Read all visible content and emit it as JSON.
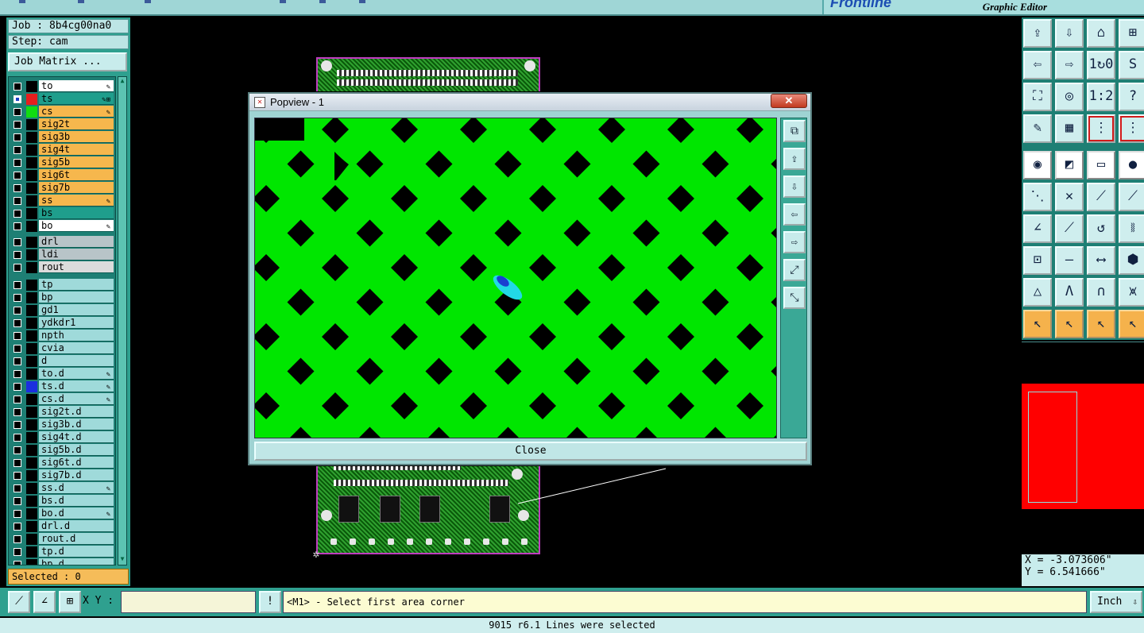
{
  "app": {
    "subtitle": "Graphic Editor",
    "brand": "Frontline"
  },
  "job": {
    "job_line": "Job : 8b4cg00na0",
    "step_line": "Step: cam",
    "matrix_button": "Job Matrix ..."
  },
  "layers_group1": [
    {
      "name": "to",
      "bg": "#ffffff",
      "swatch": "#000000",
      "selected": false,
      "mark": "✎"
    },
    {
      "name": "ts",
      "bg": "#1f9e8c",
      "swatch": "#e51e1e",
      "selected": true,
      "mark": "✎⊞"
    },
    {
      "name": "cs",
      "bg": "#f6b74d",
      "swatch": "#11dd11",
      "selected": false,
      "mark": "✎"
    },
    {
      "name": "sig2t",
      "bg": "#f6b74d",
      "swatch": "#000000",
      "selected": false,
      "mark": ""
    },
    {
      "name": "sig3b",
      "bg": "#f6b74d",
      "swatch": "#000000",
      "selected": false,
      "mark": ""
    },
    {
      "name": "sig4t",
      "bg": "#f6b74d",
      "swatch": "#000000",
      "selected": false,
      "mark": ""
    },
    {
      "name": "sig5b",
      "bg": "#f6b74d",
      "swatch": "#000000",
      "selected": false,
      "mark": ""
    },
    {
      "name": "sig6t",
      "bg": "#f6b74d",
      "swatch": "#000000",
      "selected": false,
      "mark": ""
    },
    {
      "name": "sig7b",
      "bg": "#f6b74d",
      "swatch": "#000000",
      "selected": false,
      "mark": ""
    },
    {
      "name": "ss",
      "bg": "#f6b74d",
      "swatch": "#000000",
      "selected": false,
      "mark": "✎"
    },
    {
      "name": "bs",
      "bg": "#1f9e8c",
      "swatch": "#000000",
      "selected": false,
      "mark": ""
    },
    {
      "name": "bo",
      "bg": "#ffffff",
      "swatch": "#000000",
      "selected": false,
      "mark": "✎"
    }
  ],
  "layers_group2": [
    {
      "name": "drl",
      "bg": "#b8c4c8",
      "swatch": "#000000",
      "selected": false,
      "mark": ""
    },
    {
      "name": "ldi",
      "bg": "#b8c4c8",
      "swatch": "#000000",
      "selected": false,
      "mark": ""
    },
    {
      "name": "rout",
      "bg": "#dcdcdc",
      "swatch": "#000000",
      "selected": false,
      "mark": ""
    }
  ],
  "layers_group3": [
    {
      "name": "tp",
      "bg": "#9fdada",
      "swatch": "#000000",
      "selected": false,
      "mark": ""
    },
    {
      "name": "bp",
      "bg": "#9fdada",
      "swatch": "#000000",
      "selected": false,
      "mark": ""
    },
    {
      "name": "gd1",
      "bg": "#9fdada",
      "swatch": "#000000",
      "selected": false,
      "mark": ""
    },
    {
      "name": "ydkdr1",
      "bg": "#9fdada",
      "swatch": "#000000",
      "selected": false,
      "mark": ""
    },
    {
      "name": "npth",
      "bg": "#9fdada",
      "swatch": "#000000",
      "selected": false,
      "mark": ""
    },
    {
      "name": "cvia",
      "bg": "#9fdada",
      "swatch": "#000000",
      "selected": false,
      "mark": ""
    },
    {
      "name": "d",
      "bg": "#9fdada",
      "swatch": "#000000",
      "selected": false,
      "mark": ""
    },
    {
      "name": "to.d",
      "bg": "#9fdada",
      "swatch": "#000000",
      "selected": false,
      "mark": "✎"
    },
    {
      "name": "ts.d",
      "bg": "#9fdada",
      "swatch": "#1b2fe0",
      "selected": false,
      "mark": "✎"
    },
    {
      "name": "cs.d",
      "bg": "#9fdada",
      "swatch": "#000000",
      "selected": false,
      "mark": "✎"
    },
    {
      "name": "sig2t.d",
      "bg": "#9fdada",
      "swatch": "#000000",
      "selected": false,
      "mark": ""
    },
    {
      "name": "sig3b.d",
      "bg": "#9fdada",
      "swatch": "#000000",
      "selected": false,
      "mark": ""
    },
    {
      "name": "sig4t.d",
      "bg": "#9fdada",
      "swatch": "#000000",
      "selected": false,
      "mark": ""
    },
    {
      "name": "sig5b.d",
      "bg": "#9fdada",
      "swatch": "#000000",
      "selected": false,
      "mark": ""
    },
    {
      "name": "sig6t.d",
      "bg": "#9fdada",
      "swatch": "#000000",
      "selected": false,
      "mark": ""
    },
    {
      "name": "sig7b.d",
      "bg": "#9fdada",
      "swatch": "#000000",
      "selected": false,
      "mark": ""
    },
    {
      "name": "ss.d",
      "bg": "#9fdada",
      "swatch": "#000000",
      "selected": false,
      "mark": "✎"
    },
    {
      "name": "bs.d",
      "bg": "#9fdada",
      "swatch": "#000000",
      "selected": false,
      "mark": ""
    },
    {
      "name": "bo.d",
      "bg": "#9fdada",
      "swatch": "#000000",
      "selected": false,
      "mark": "✎"
    },
    {
      "name": "drl.d",
      "bg": "#9fdada",
      "swatch": "#000000",
      "selected": false,
      "mark": ""
    },
    {
      "name": "rout.d",
      "bg": "#9fdada",
      "swatch": "#000000",
      "selected": false,
      "mark": ""
    },
    {
      "name": "tp.d",
      "bg": "#9fdada",
      "swatch": "#000000",
      "selected": false,
      "mark": ""
    },
    {
      "name": "bp.d",
      "bg": "#9fdada",
      "swatch": "#000000",
      "selected": false,
      "mark": ""
    }
  ],
  "selected_counter": "Selected : 0",
  "popview": {
    "title": "Popview - 1",
    "close_x": "✕",
    "close_button": "Close",
    "tools": [
      "⧉",
      "⇪",
      "⇩",
      "⇦",
      "⇨",
      "⤢",
      "⤡"
    ]
  },
  "right_toolbar": {
    "buttons": [
      {
        "name": "zoom-home-button",
        "icon": "⇪",
        "style": ""
      },
      {
        "name": "zoom-down-button",
        "icon": "⇩",
        "style": ""
      },
      {
        "name": "home-button",
        "icon": "⌂",
        "style": ""
      },
      {
        "name": "window-layout-button",
        "icon": "⊞",
        "style": ""
      },
      {
        "name": "pan-left-button",
        "icon": "⇦",
        "style": ""
      },
      {
        "name": "pan-right-button",
        "icon": "⇨",
        "style": ""
      },
      {
        "name": "one-to-zero-button",
        "icon": "1↻0",
        "style": ""
      },
      {
        "name": "snap-button",
        "icon": "S",
        "style": ""
      },
      {
        "name": "fit-button",
        "icon": "⛶",
        "style": ""
      },
      {
        "name": "center-button",
        "icon": "◎",
        "style": ""
      },
      {
        "name": "ratio-button",
        "icon": "1:2",
        "style": ""
      },
      {
        "name": "help-button",
        "icon": "?",
        "style": ""
      },
      {
        "name": "measure-button",
        "icon": "✎",
        "style": ""
      },
      {
        "name": "grid-button",
        "icon": "▦",
        "style": ""
      },
      {
        "name": "net-connect-button",
        "icon": "⋮",
        "style": "redframe"
      },
      {
        "name": "net-highlight-button",
        "icon": "⋮",
        "style": "redframe"
      },
      {
        "name": "pad-select-button",
        "icon": "◉",
        "style": "white"
      },
      {
        "name": "layer-color-button",
        "icon": "◩",
        "style": "white"
      },
      {
        "name": "ruler-button",
        "icon": "▭",
        "style": "white"
      },
      {
        "name": "circle-button",
        "icon": "●",
        "style": "white"
      },
      {
        "name": "connect-points-button",
        "icon": "⋱",
        "style": ""
      },
      {
        "name": "cross-button",
        "icon": "✕",
        "style": ""
      },
      {
        "name": "line-point-button",
        "icon": "⟋",
        "style": ""
      },
      {
        "name": "line-end-button",
        "icon": "⟋",
        "style": ""
      },
      {
        "name": "angle-line-button",
        "icon": "∠",
        "style": ""
      },
      {
        "name": "diagonal-button",
        "icon": "⟋",
        "style": ""
      },
      {
        "name": "arc-button",
        "icon": "↺",
        "style": ""
      },
      {
        "name": "mirror-button",
        "icon": "⧚",
        "style": ""
      },
      {
        "name": "move-pad-button",
        "icon": "⊡",
        "style": ""
      },
      {
        "name": "horizontal-line-button",
        "icon": "—",
        "style": ""
      },
      {
        "name": "dimension-button",
        "icon": "⟷",
        "style": ""
      },
      {
        "name": "shapes-button",
        "icon": "⬢",
        "style": ""
      },
      {
        "name": "triangle-button",
        "icon": "△",
        "style": ""
      },
      {
        "name": "a-shape-button",
        "icon": "Λ",
        "style": ""
      },
      {
        "name": "arch-button",
        "icon": "∩",
        "style": ""
      },
      {
        "name": "cross-shape-button",
        "icon": "⩙",
        "style": ""
      },
      {
        "name": "select-button",
        "icon": "↖",
        "style": "orange"
      },
      {
        "name": "select-box-button",
        "icon": "↖",
        "style": "orange"
      },
      {
        "name": "select-poly-button",
        "icon": "↖",
        "style": "orange"
      },
      {
        "name": "select-step-button",
        "icon": "↖",
        "style": "orange"
      }
    ]
  },
  "coords": {
    "x": "X = -3.073606\"",
    "y": "Y =  6.541666\""
  },
  "bottom": {
    "xy_label": "X Y :",
    "xy_value": "",
    "exclaim": "!",
    "prompt": "<M1> - Select first area corner",
    "units": "Inch",
    "units_arrow": "⇩"
  },
  "status": "9015 r6.1 Lines were selected"
}
